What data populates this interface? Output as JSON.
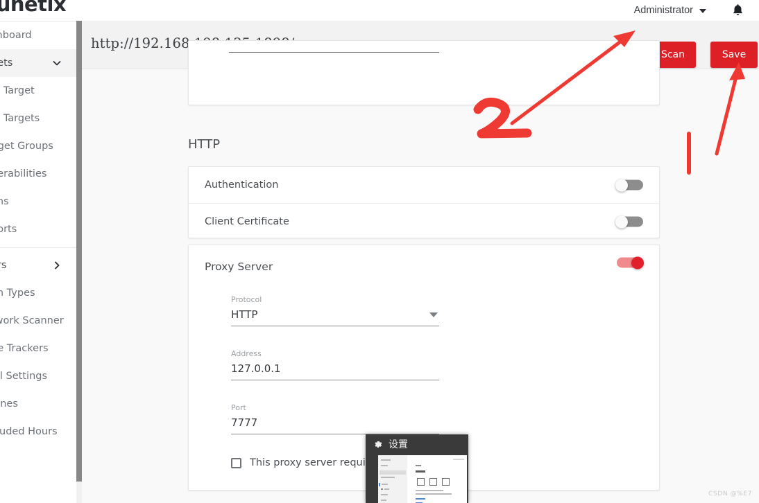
{
  "app": {
    "logo_text": "cunetix",
    "user_label": "Administrator",
    "caret_icon": "chevron-down-icon",
    "bell_icon": "bell-icon"
  },
  "sidebar": {
    "items": [
      {
        "label": "shboard",
        "icon": "dashboard-icon",
        "chevron": "",
        "highlight": false
      },
      {
        "label": "gets",
        "icon": "targets-icon",
        "chevron": "chevron-down-icon",
        "highlight": true
      },
      {
        "label": "d Target",
        "icon": "add-target-icon",
        "chevron": "",
        "highlight": false
      },
      {
        "label": "d Targets",
        "icon": "add-targets-icon",
        "chevron": "",
        "highlight": false
      },
      {
        "label": "rget Groups",
        "icon": "target-groups-icon",
        "chevron": "",
        "highlight": false
      },
      {
        "label": "nerabilities",
        "icon": "vulnerabilities-icon",
        "chevron": "",
        "highlight": false
      },
      {
        "label": "ans",
        "icon": "scans-icon",
        "chevron": "",
        "highlight": false
      },
      {
        "label": "ports",
        "icon": "reports-icon",
        "chevron": "",
        "highlight": false
      }
    ],
    "items_lower": [
      {
        "label": "ers",
        "icon": "users-icon",
        "chevron": "chevron-right-icon",
        "highlight": false
      },
      {
        "label": "an Types",
        "icon": "scan-types-icon",
        "chevron": "",
        "highlight": false
      },
      {
        "label": "twork Scanner",
        "icon": "network-scanner-icon",
        "chevron": "",
        "highlight": false
      },
      {
        "label": "ue Trackers",
        "icon": "issue-trackers-icon",
        "chevron": "",
        "highlight": false
      },
      {
        "label": "ail Settings",
        "icon": "email-settings-icon",
        "chevron": "",
        "highlight": false
      },
      {
        "label": "gines",
        "icon": "engines-icon",
        "chevron": "",
        "highlight": false
      },
      {
        "label": "cluded Hours",
        "icon": "excluded-hours-icon",
        "chevron": "",
        "highlight": false
      }
    ]
  },
  "target": {
    "url": "http://192.168.198.135:1898/",
    "scan_label": "Scan",
    "scan_icon": "radar-scan-icon",
    "save_label": "Save"
  },
  "http_section": {
    "title": "HTTP",
    "rows": [
      {
        "label": "Authentication",
        "toggle_state": "off"
      },
      {
        "label": "Client Certificate",
        "toggle_state": "off"
      }
    ]
  },
  "proxy": {
    "title": "Proxy Server",
    "toggle_state": "on",
    "protocol": {
      "label": "Protocol",
      "value": "HTTP",
      "caret_icon": "dropdown-caret-icon"
    },
    "address": {
      "label": "Address",
      "value": "127.0.0.1"
    },
    "port": {
      "label": "Port",
      "value": "7777"
    },
    "auth_checkbox": {
      "label": "This proxy server requires authentication",
      "checked": false
    }
  },
  "annotations": {
    "marker_2": "2",
    "marker_1": "1",
    "arrow_to_scan": "arrow-pointing-to-scan-button",
    "arrow_to_save": "arrow-pointing-to-save-button",
    "color": "#ee3a33"
  },
  "overlay_popup": {
    "gear_icon": "gear-icon",
    "title": "设置"
  },
  "watermark": "CSDN @%E7",
  "colors": {
    "brand_red": "#dd1f26",
    "toggle_on": "#e2202b",
    "toggle_off": "#8d8d8d",
    "content_bg": "#f9f9f9",
    "header_bg": "#f2f2f2"
  }
}
